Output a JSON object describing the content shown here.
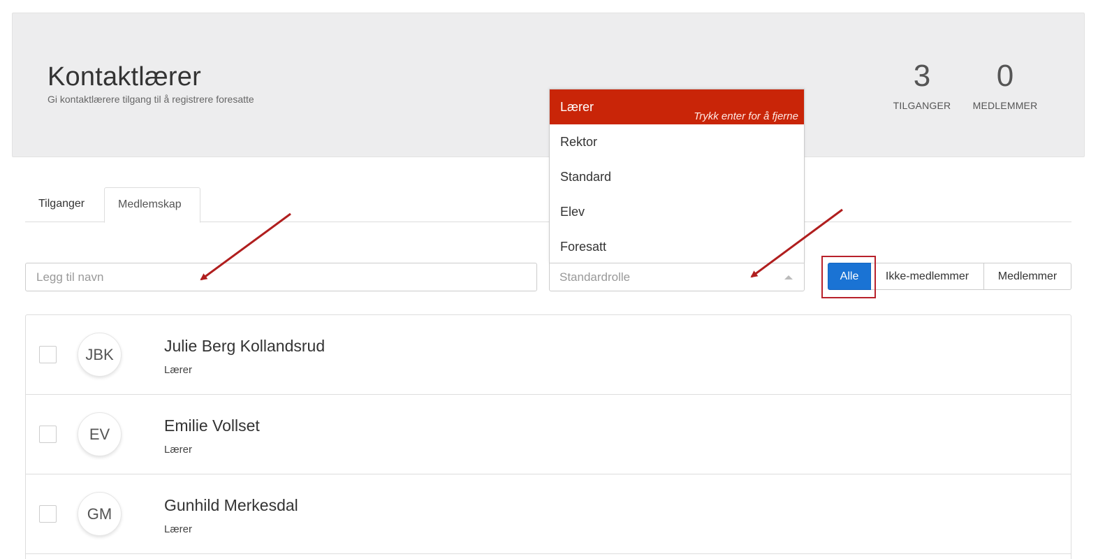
{
  "header": {
    "title": "Kontaktlærer",
    "subtitle": "Gi kontaktlærere tilgang til å registrere foresatte",
    "stats": [
      {
        "value": "3",
        "label": "TILGANGER"
      },
      {
        "value": "0",
        "label": "MEDLEMMER"
      }
    ]
  },
  "tabs": [
    {
      "label": "Tilganger"
    },
    {
      "label": "Medlemskap"
    }
  ],
  "filters": {
    "name_placeholder": "Legg til navn",
    "role_placeholder": "Standardrolle",
    "role_options": [
      {
        "label": "Lærer",
        "hint": "Trykk enter for å fjerne"
      },
      {
        "label": "Rektor"
      },
      {
        "label": "Standard"
      },
      {
        "label": "Elev"
      },
      {
        "label": "Foresatt"
      }
    ],
    "segment": {
      "all": "Alle",
      "non_members": "Ikke-medlemmer",
      "members": "Medlemmer"
    }
  },
  "members": [
    {
      "initials": "JBK",
      "name": "Julie Berg Kollandsrud",
      "role": "Lærer"
    },
    {
      "initials": "EV",
      "name": "Emilie Vollset",
      "role": "Lærer"
    },
    {
      "initials": "GM",
      "name": "Gunhild Merkesdal",
      "role": "Lærer"
    }
  ],
  "colors": {
    "selected_option": "#c92508",
    "primary_button": "#1a73d4",
    "annotation": "#b8212b",
    "header_bg": "#ededee"
  }
}
